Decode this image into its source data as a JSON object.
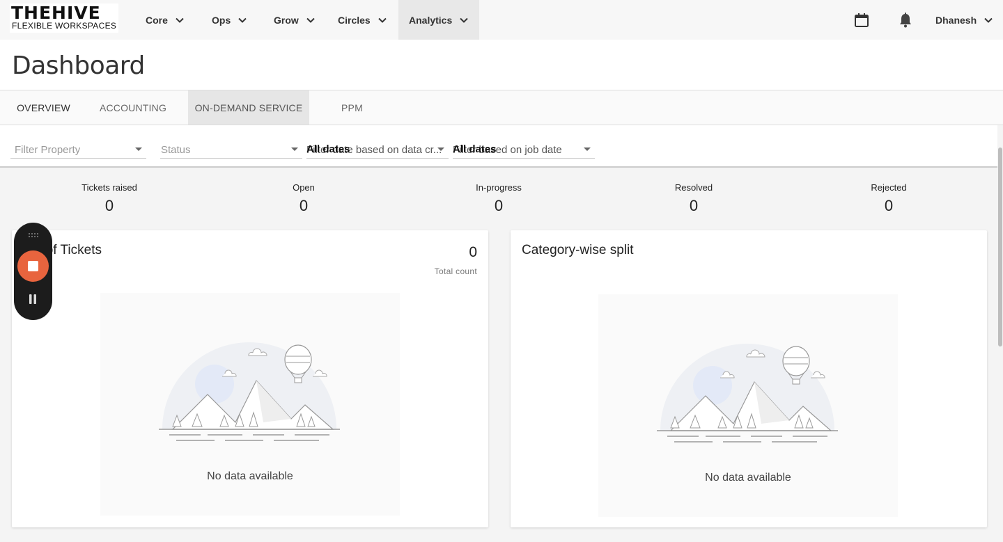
{
  "brand": {
    "line1": "THEHIVE",
    "line2": "FLEXIBLE WORKSPACES"
  },
  "nav": {
    "items": [
      {
        "label": "Core"
      },
      {
        "label": "Ops"
      },
      {
        "label": "Grow"
      },
      {
        "label": "Circles"
      },
      {
        "label": "Analytics",
        "active": true
      }
    ],
    "icons": [
      "calendar-icon",
      "bell-icon"
    ],
    "user": "Dhanesh"
  },
  "page": {
    "title": "Dashboard"
  },
  "tabs": [
    {
      "label": "OVERVIEW"
    },
    {
      "label": "ACCOUNTING"
    },
    {
      "label": "ON-DEMAND SERVICE",
      "selected": true
    },
    {
      "label": "PPM"
    }
  ],
  "filters": {
    "property_placeholder": "Filter Property",
    "status_placeholder": "Status",
    "date_created": {
      "label": "Filter date based on data cr...",
      "value": "All dates"
    },
    "job_date": {
      "label": "Filter based on job date",
      "value": "All dates"
    }
  },
  "stats": [
    {
      "label": "Tickets raised",
      "value": "0"
    },
    {
      "label": "Open",
      "value": "0"
    },
    {
      "label": "In-progress",
      "value": "0"
    },
    {
      "label": "Resolved",
      "value": "0"
    },
    {
      "label": "Rejected",
      "value": "0"
    }
  ],
  "cards": {
    "tickets": {
      "title": "ber of Tickets",
      "count": "0",
      "count_label": "Total count",
      "empty": "No data available"
    },
    "category": {
      "title": "Category-wise split",
      "empty": "No data available"
    }
  },
  "recorder": {
    "icons": [
      "grip-icon",
      "stop-icon",
      "pause-icon"
    ],
    "stop_color": "#e8643e"
  }
}
